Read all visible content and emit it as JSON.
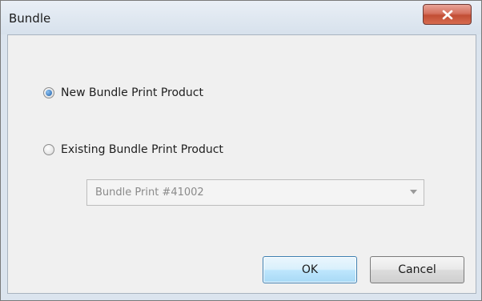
{
  "window": {
    "title": "Bundle",
    "close_icon": "close-x-icon"
  },
  "options": {
    "new_bundle_label": "New Bundle Print Product",
    "existing_bundle_label": "Existing Bundle Print Product",
    "selected": "new_bundle"
  },
  "dropdown": {
    "selected_value": "Bundle Print #41002",
    "icon": "chevron-down-icon"
  },
  "buttons": {
    "ok_label": "OK",
    "cancel_label": "Cancel"
  },
  "colors": {
    "close_button": "#c9543c",
    "default_button_border": "#3c7fb1",
    "radio_selected": "#1d5fa8"
  }
}
